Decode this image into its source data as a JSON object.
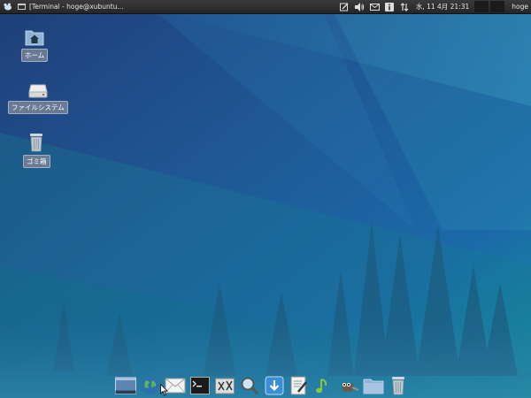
{
  "panel": {
    "window_title": "[Terminal - hoge@xubuntu...",
    "clock": "水, 11 4月  21:31",
    "user": "hoge"
  },
  "desktop": {
    "icons": [
      {
        "label": "ホーム",
        "icon": "home-folder-icon"
      },
      {
        "label": "ファイルシステム",
        "icon": "drive-icon"
      },
      {
        "label": "ゴミ箱",
        "icon": "trash-icon"
      }
    ]
  },
  "dock": {
    "items": [
      "desktop-icon",
      "web-browser-icon",
      "mail-icon",
      "terminal-icon",
      "settings-icon",
      "search-icon",
      "download-icon",
      "text-editor-icon",
      "media-player-icon",
      "gimp-icon",
      "folder-icon",
      "trash-icon"
    ]
  },
  "colors": {
    "panel_bg": "#2e2e2e",
    "wallpaper_top": "#1f4d86",
    "wallpaper_bottom": "#10807f"
  }
}
